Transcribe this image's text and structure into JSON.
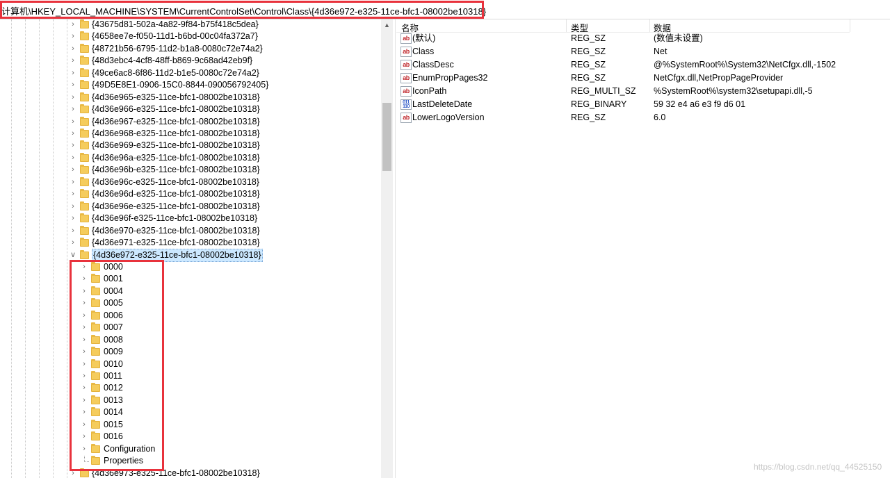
{
  "address": "计算机\\HKEY_LOCAL_MACHINE\\SYSTEM\\CurrentControlSet\\Control\\Class\\{4d36e972-e325-11ce-bfc1-08002be10318}",
  "tree": {
    "class_keys": [
      "{43675d81-502a-4a82-9f84-b75f418c5dea}",
      "{4658ee7e-f050-11d1-b6bd-00c04fa372a7}",
      "{48721b56-6795-11d2-b1a8-0080c72e74a2}",
      "{48d3ebc4-4cf8-48ff-b869-9c68ad42eb9f}",
      "{49ce6ac8-6f86-11d2-b1e5-0080c72e74a2}",
      "{49D5E8E1-0906-15C0-8844-090056792405}",
      "{4d36e965-e325-11ce-bfc1-08002be10318}",
      "{4d36e966-e325-11ce-bfc1-08002be10318}",
      "{4d36e967-e325-11ce-bfc1-08002be10318}",
      "{4d36e968-e325-11ce-bfc1-08002be10318}",
      "{4d36e969-e325-11ce-bfc1-08002be10318}",
      "{4d36e96a-e325-11ce-bfc1-08002be10318}",
      "{4d36e96b-e325-11ce-bfc1-08002be10318}",
      "{4d36e96c-e325-11ce-bfc1-08002be10318}",
      "{4d36e96d-e325-11ce-bfc1-08002be10318}",
      "{4d36e96e-e325-11ce-bfc1-08002be10318}",
      "{4d36e96f-e325-11ce-bfc1-08002be10318}",
      "{4d36e970-e325-11ce-bfc1-08002be10318}",
      "{4d36e971-e325-11ce-bfc1-08002be10318}"
    ],
    "selected_key": "{4d36e972-e325-11ce-bfc1-08002be10318}",
    "sub_keys": [
      "0000",
      "0001",
      "0004",
      "0005",
      "0006",
      "0007",
      "0008",
      "0009",
      "0010",
      "0011",
      "0012",
      "0013",
      "0014",
      "0015",
      "0016",
      "Configuration"
    ],
    "leaf_key": "Properties",
    "next_key": "{4d36e973-e325-11ce-bfc1-08002be10318}"
  },
  "values": {
    "headers": {
      "name": "名称",
      "type": "类型",
      "data": "数据"
    },
    "rows": [
      {
        "icon": "ab",
        "name": "(默认)",
        "type": "REG_SZ",
        "data": "(数值未设置)"
      },
      {
        "icon": "ab",
        "name": "Class",
        "type": "REG_SZ",
        "data": "Net"
      },
      {
        "icon": "ab",
        "name": "ClassDesc",
        "type": "REG_SZ",
        "data": "@%SystemRoot%\\System32\\NetCfgx.dll,-1502"
      },
      {
        "icon": "ab",
        "name": "EnumPropPages32",
        "type": "REG_SZ",
        "data": "NetCfgx.dll,NetPropPageProvider"
      },
      {
        "icon": "ab",
        "name": "IconPath",
        "type": "REG_MULTI_SZ",
        "data": "%SystemRoot%\\system32\\setupapi.dll,-5"
      },
      {
        "icon": "binary",
        "name": "LastDeleteDate",
        "type": "REG_BINARY",
        "data": "59 32 e4 a6 e3 f9 d6 01"
      },
      {
        "icon": "ab",
        "name": "LowerLogoVersion",
        "type": "REG_SZ",
        "data": "6.0"
      }
    ]
  },
  "watermark": "https://blog.csdn.net/qq_44525150",
  "colors": {
    "highlight_box": "#e8323c",
    "selection": "#cce8ff",
    "folder": "#f5cc5c"
  }
}
